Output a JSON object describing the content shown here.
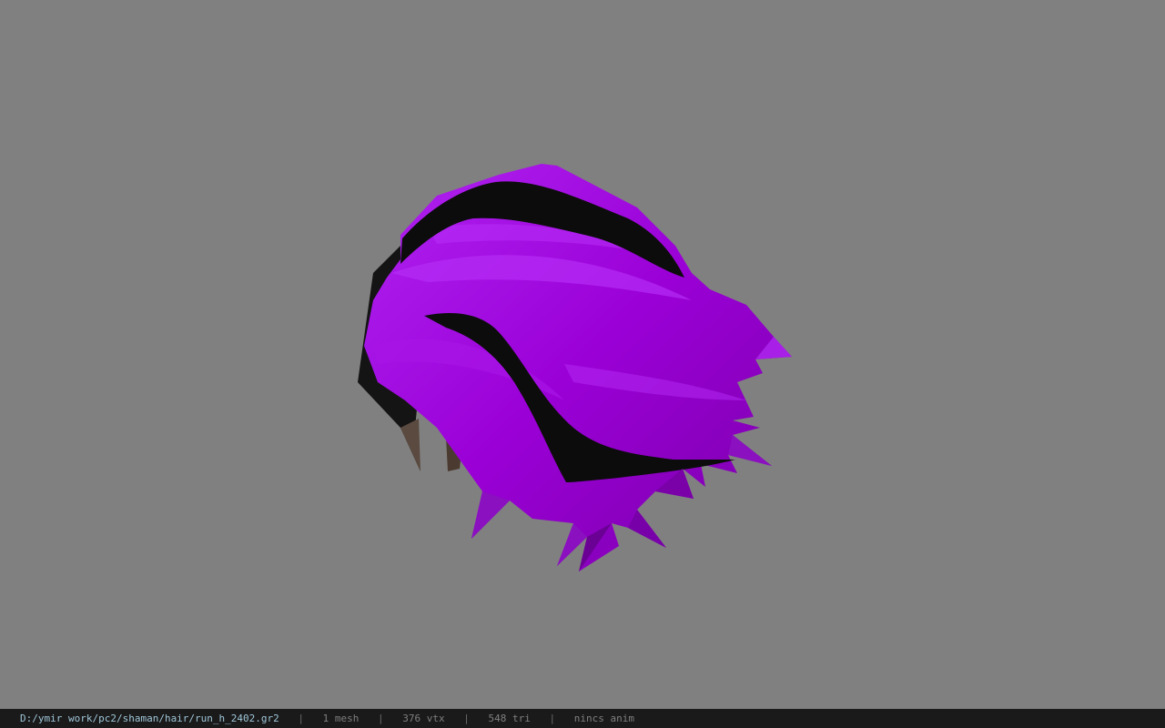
{
  "viewport": {
    "background": "#808080",
    "model": "purple-hair-mesh"
  },
  "colors": {
    "hair_primary": "#9a00d6",
    "hair_light": "#b020f0",
    "hair_dark": "#6a0094",
    "stripe": "#0c0c0c",
    "skin": "#5a4a40"
  },
  "statusbar": {
    "path": "D:/ymir work/pc2/shaman/hair/run_h_2402.gr2",
    "separator": "|",
    "mesh": "1 mesh",
    "vtx": "376 vtx",
    "tri": "548 tri",
    "anim": "nincs anim"
  }
}
